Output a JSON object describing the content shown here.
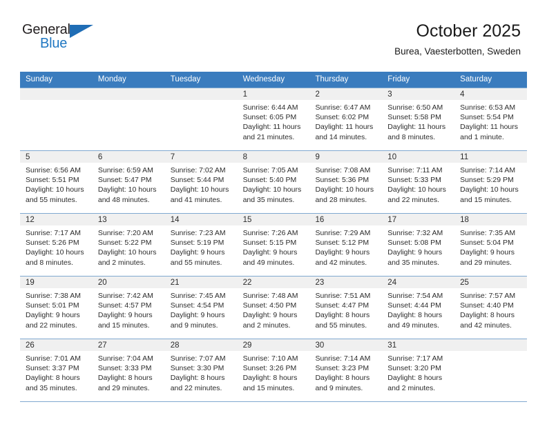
{
  "brand": {
    "general": "General",
    "blue": "Blue",
    "flag_icon": "triangle-flag-icon"
  },
  "header": {
    "title": "October 2025",
    "location": "Burea, Vaesterbotten, Sweden"
  },
  "theme": {
    "header_blue": "#3a7cbe",
    "brand_blue": "#1f77c2",
    "cell_shade": "#f0f0f0",
    "grid_line": "#7fa8d0"
  },
  "weekdays": [
    "Sunday",
    "Monday",
    "Tuesday",
    "Wednesday",
    "Thursday",
    "Friday",
    "Saturday"
  ],
  "labels": {
    "sunrise_prefix": "Sunrise:",
    "sunset_prefix": "Sunset:",
    "daylight_prefix": "Daylight:"
  },
  "weeks": [
    [
      {
        "day": "",
        "sunrise": "",
        "sunset": "",
        "daylight": ""
      },
      {
        "day": "",
        "sunrise": "",
        "sunset": "",
        "daylight": ""
      },
      {
        "day": "",
        "sunrise": "",
        "sunset": "",
        "daylight": ""
      },
      {
        "day": "1",
        "sunrise": "Sunrise: 6:44 AM",
        "sunset": "Sunset: 6:05 PM",
        "daylight": "Daylight: 11 hours and 21 minutes."
      },
      {
        "day": "2",
        "sunrise": "Sunrise: 6:47 AM",
        "sunset": "Sunset: 6:02 PM",
        "daylight": "Daylight: 11 hours and 14 minutes."
      },
      {
        "day": "3",
        "sunrise": "Sunrise: 6:50 AM",
        "sunset": "Sunset: 5:58 PM",
        "daylight": "Daylight: 11 hours and 8 minutes."
      },
      {
        "day": "4",
        "sunrise": "Sunrise: 6:53 AM",
        "sunset": "Sunset: 5:54 PM",
        "daylight": "Daylight: 11 hours and 1 minute."
      }
    ],
    [
      {
        "day": "5",
        "sunrise": "Sunrise: 6:56 AM",
        "sunset": "Sunset: 5:51 PM",
        "daylight": "Daylight: 10 hours and 55 minutes."
      },
      {
        "day": "6",
        "sunrise": "Sunrise: 6:59 AM",
        "sunset": "Sunset: 5:47 PM",
        "daylight": "Daylight: 10 hours and 48 minutes."
      },
      {
        "day": "7",
        "sunrise": "Sunrise: 7:02 AM",
        "sunset": "Sunset: 5:44 PM",
        "daylight": "Daylight: 10 hours and 41 minutes."
      },
      {
        "day": "8",
        "sunrise": "Sunrise: 7:05 AM",
        "sunset": "Sunset: 5:40 PM",
        "daylight": "Daylight: 10 hours and 35 minutes."
      },
      {
        "day": "9",
        "sunrise": "Sunrise: 7:08 AM",
        "sunset": "Sunset: 5:36 PM",
        "daylight": "Daylight: 10 hours and 28 minutes."
      },
      {
        "day": "10",
        "sunrise": "Sunrise: 7:11 AM",
        "sunset": "Sunset: 5:33 PM",
        "daylight": "Daylight: 10 hours and 22 minutes."
      },
      {
        "day": "11",
        "sunrise": "Sunrise: 7:14 AM",
        "sunset": "Sunset: 5:29 PM",
        "daylight": "Daylight: 10 hours and 15 minutes."
      }
    ],
    [
      {
        "day": "12",
        "sunrise": "Sunrise: 7:17 AM",
        "sunset": "Sunset: 5:26 PM",
        "daylight": "Daylight: 10 hours and 8 minutes."
      },
      {
        "day": "13",
        "sunrise": "Sunrise: 7:20 AM",
        "sunset": "Sunset: 5:22 PM",
        "daylight": "Daylight: 10 hours and 2 minutes."
      },
      {
        "day": "14",
        "sunrise": "Sunrise: 7:23 AM",
        "sunset": "Sunset: 5:19 PM",
        "daylight": "Daylight: 9 hours and 55 minutes."
      },
      {
        "day": "15",
        "sunrise": "Sunrise: 7:26 AM",
        "sunset": "Sunset: 5:15 PM",
        "daylight": "Daylight: 9 hours and 49 minutes."
      },
      {
        "day": "16",
        "sunrise": "Sunrise: 7:29 AM",
        "sunset": "Sunset: 5:12 PM",
        "daylight": "Daylight: 9 hours and 42 minutes."
      },
      {
        "day": "17",
        "sunrise": "Sunrise: 7:32 AM",
        "sunset": "Sunset: 5:08 PM",
        "daylight": "Daylight: 9 hours and 35 minutes."
      },
      {
        "day": "18",
        "sunrise": "Sunrise: 7:35 AM",
        "sunset": "Sunset: 5:04 PM",
        "daylight": "Daylight: 9 hours and 29 minutes."
      }
    ],
    [
      {
        "day": "19",
        "sunrise": "Sunrise: 7:38 AM",
        "sunset": "Sunset: 5:01 PM",
        "daylight": "Daylight: 9 hours and 22 minutes."
      },
      {
        "day": "20",
        "sunrise": "Sunrise: 7:42 AM",
        "sunset": "Sunset: 4:57 PM",
        "daylight": "Daylight: 9 hours and 15 minutes."
      },
      {
        "day": "21",
        "sunrise": "Sunrise: 7:45 AM",
        "sunset": "Sunset: 4:54 PM",
        "daylight": "Daylight: 9 hours and 9 minutes."
      },
      {
        "day": "22",
        "sunrise": "Sunrise: 7:48 AM",
        "sunset": "Sunset: 4:50 PM",
        "daylight": "Daylight: 9 hours and 2 minutes."
      },
      {
        "day": "23",
        "sunrise": "Sunrise: 7:51 AM",
        "sunset": "Sunset: 4:47 PM",
        "daylight": "Daylight: 8 hours and 55 minutes."
      },
      {
        "day": "24",
        "sunrise": "Sunrise: 7:54 AM",
        "sunset": "Sunset: 4:44 PM",
        "daylight": "Daylight: 8 hours and 49 minutes."
      },
      {
        "day": "25",
        "sunrise": "Sunrise: 7:57 AM",
        "sunset": "Sunset: 4:40 PM",
        "daylight": "Daylight: 8 hours and 42 minutes."
      }
    ],
    [
      {
        "day": "26",
        "sunrise": "Sunrise: 7:01 AM",
        "sunset": "Sunset: 3:37 PM",
        "daylight": "Daylight: 8 hours and 35 minutes."
      },
      {
        "day": "27",
        "sunrise": "Sunrise: 7:04 AM",
        "sunset": "Sunset: 3:33 PM",
        "daylight": "Daylight: 8 hours and 29 minutes."
      },
      {
        "day": "28",
        "sunrise": "Sunrise: 7:07 AM",
        "sunset": "Sunset: 3:30 PM",
        "daylight": "Daylight: 8 hours and 22 minutes."
      },
      {
        "day": "29",
        "sunrise": "Sunrise: 7:10 AM",
        "sunset": "Sunset: 3:26 PM",
        "daylight": "Daylight: 8 hours and 15 minutes."
      },
      {
        "day": "30",
        "sunrise": "Sunrise: 7:14 AM",
        "sunset": "Sunset: 3:23 PM",
        "daylight": "Daylight: 8 hours and 9 minutes."
      },
      {
        "day": "31",
        "sunrise": "Sunrise: 7:17 AM",
        "sunset": "Sunset: 3:20 PM",
        "daylight": "Daylight: 8 hours and 2 minutes."
      },
      {
        "day": "",
        "sunrise": "",
        "sunset": "",
        "daylight": ""
      }
    ]
  ]
}
